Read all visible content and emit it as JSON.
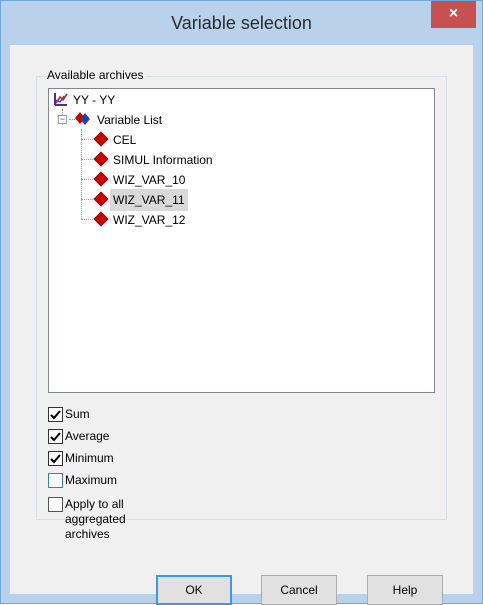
{
  "window": {
    "title": "Variable selection",
    "close_glyph": "×"
  },
  "group": {
    "label": "Available archives"
  },
  "tree": {
    "root": {
      "label": "YY - YY",
      "icon": "archive-icon"
    },
    "variable_list": {
      "label": "Variable List",
      "icon": "variable-list-icon",
      "expander": "−"
    },
    "items": [
      {
        "label": "CEL",
        "icon": "variable-diamond-icon",
        "selected": false
      },
      {
        "label": "SIMUL Information",
        "icon": "variable-diamond-icon",
        "selected": false
      },
      {
        "label": "WIZ_VAR_10",
        "icon": "variable-diamond-icon",
        "selected": false
      },
      {
        "label": "WIZ_VAR_11",
        "icon": "variable-diamond-icon",
        "selected": true
      },
      {
        "label": "WIZ_VAR_12",
        "icon": "variable-diamond-icon",
        "selected": false
      }
    ]
  },
  "options": [
    {
      "label": "Sum",
      "checked": true
    },
    {
      "label": "Average",
      "checked": true
    },
    {
      "label": "Minimum",
      "checked": true
    },
    {
      "label": "Maximum",
      "checked": false
    }
  ],
  "apply_all": {
    "label": "Apply to all aggregated archives",
    "checked": false
  },
  "buttons": {
    "ok": "OK",
    "cancel": "Cancel",
    "help": "Help"
  },
  "colors": {
    "diamond": "#cc0000",
    "selection": "#d9d9d9",
    "titlebar": "#b9d1ea",
    "close": "#c75050"
  }
}
